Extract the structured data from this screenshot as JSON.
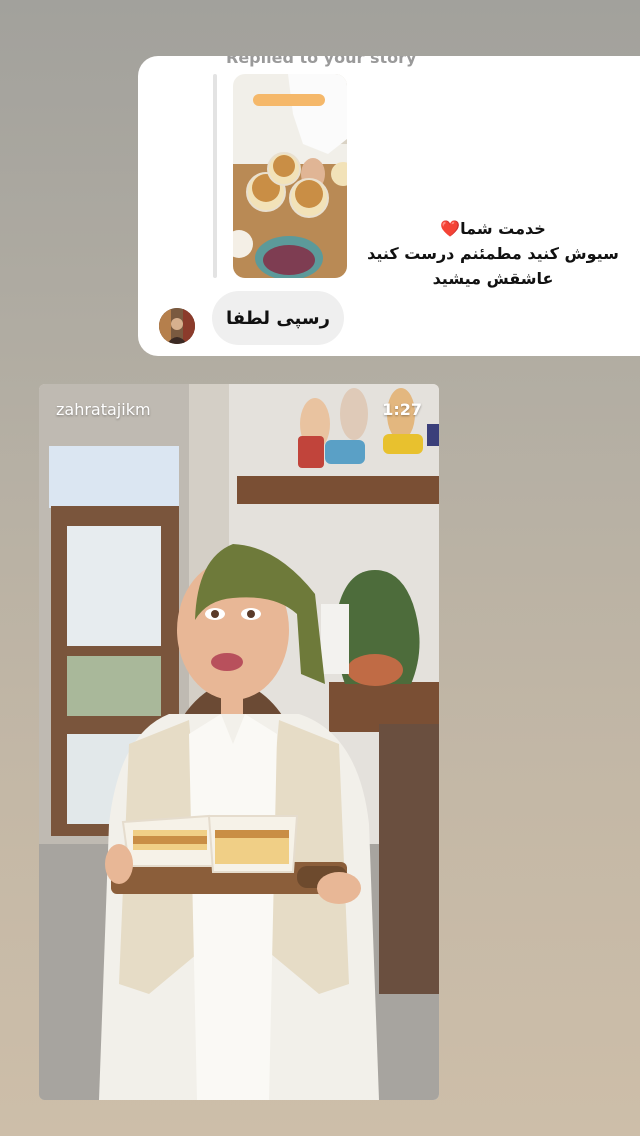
{
  "story_reply": {
    "replied_label": "Replied to your story",
    "reply_lines": [
      "خدمت شما",
      "سیوش کنید مطمئنم درست کنید",
      "عاشقش میشید"
    ],
    "heart_glyph": "❤️",
    "message": "رسپی لطفا"
  },
  "video": {
    "username": "zahratajikm",
    "duration": "1:27"
  }
}
